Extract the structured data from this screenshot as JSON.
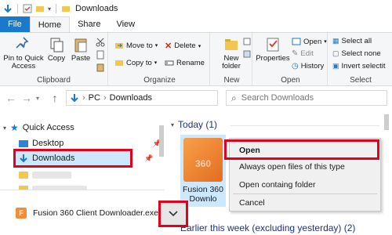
{
  "window": {
    "title": "Downloads"
  },
  "ribbon": {
    "tabs": [
      "File",
      "Home",
      "Share",
      "View"
    ],
    "clipboard": {
      "label": "Clipboard",
      "pin": "Pin to Quick Access",
      "copy": "Copy",
      "paste": "Paste"
    },
    "organize": {
      "label": "Organize",
      "move_to": "Move to",
      "copy_to": "Copy to",
      "delete": "Delete",
      "rename": "Rename"
    },
    "new": {
      "label": "New",
      "new_folder": "New folder"
    },
    "open": {
      "label": "Open",
      "properties": "Properties",
      "open": "Open",
      "edit": "Edit",
      "history": "History"
    },
    "select": {
      "label": "Select",
      "select_all": "Select all",
      "select_none": "Select none",
      "invert": "Invert selectit"
    }
  },
  "address": {
    "pc": "PC",
    "folder": "Downloads",
    "search_placeholder": "Search Downloads"
  },
  "nav": {
    "quick_access": "Quick Access",
    "desktop": "Desktop",
    "downloads": "Downloads"
  },
  "content": {
    "group_today": "Today (1)",
    "group_earlier": "Earlier this week (excluding yesterday) (2)",
    "file_label_line1": "Fusion 360",
    "file_label_line2": "Downlo"
  },
  "context_menu": {
    "open": "Open",
    "always_open": "Always open files of this type",
    "open_folder": "Open containg folder",
    "cancel": "Cancel"
  },
  "download_bar": {
    "file_name": "Fusion 360 Client Downloader.exe"
  },
  "colors": {
    "accent": "#1979ca",
    "highlight": "#e3001b",
    "selection": "#cce8ff"
  }
}
